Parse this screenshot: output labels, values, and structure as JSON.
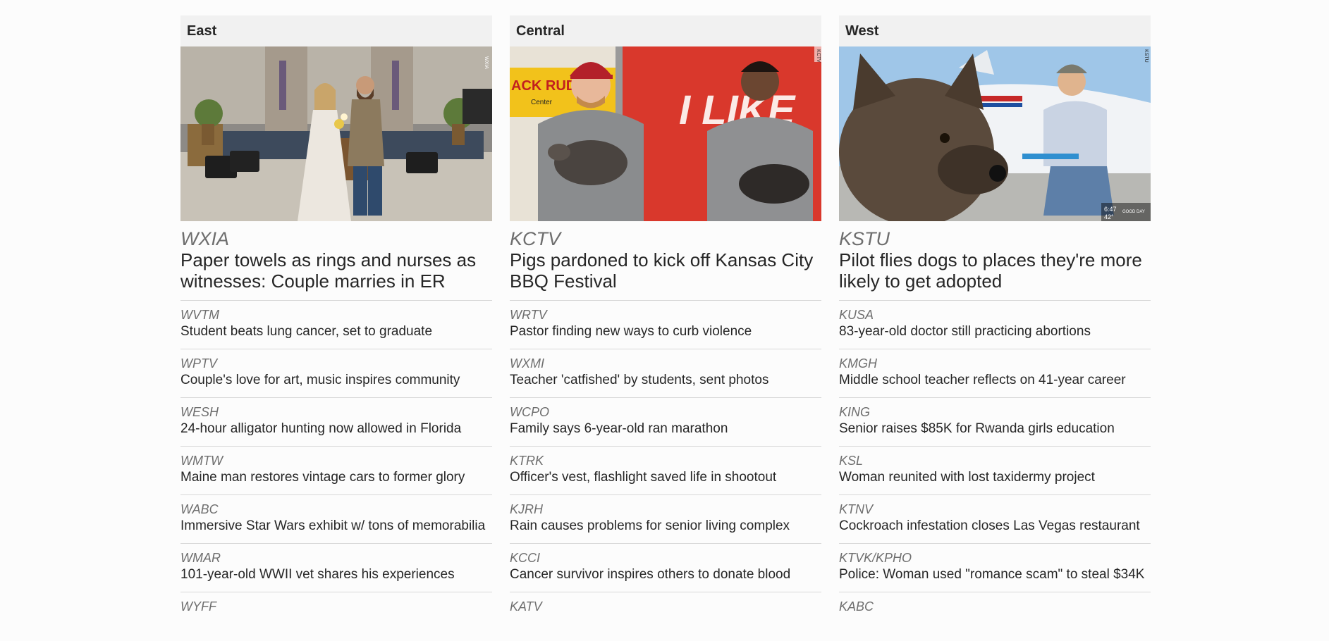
{
  "columns": [
    {
      "region": "East",
      "image_alt": "Bride and groom standing at front of a church stage",
      "lead": {
        "station": "WXIA",
        "headline": "Paper towels as rings and nurses as witnesses: Couple marries in ER"
      },
      "stories": [
        {
          "station": "WVTM",
          "headline": "Student beats lung cancer, set to graduate"
        },
        {
          "station": "WPTV",
          "headline": "Couple's love for art, music inspires community"
        },
        {
          "station": "WESH",
          "headline": "24-hour alligator hunting now allowed in Florida"
        },
        {
          "station": "WMTW",
          "headline": "Maine man restores vintage cars to former glory"
        },
        {
          "station": "WABC",
          "headline": "Immersive Star Wars exhibit w/ tons of memorabilia"
        },
        {
          "station": "WMAR",
          "headline": "101-year-old WWII vet shares his experiences"
        },
        {
          "station": "WYFF",
          "headline": ""
        }
      ]
    },
    {
      "region": "Central",
      "image_alt": "Two men holding small pigs in front of a red sign",
      "lead": {
        "station": "KCTV",
        "headline": "Pigs pardoned to kick off Kansas City BBQ Festival"
      },
      "stories": [
        {
          "station": "WRTV",
          "headline": "Pastor finding new ways to curb violence"
        },
        {
          "station": "WXMI",
          "headline": "Teacher 'catfished' by students, sent photos"
        },
        {
          "station": "WCPO",
          "headline": "Family says 6-year-old ran marathon"
        },
        {
          "station": "KTRK",
          "headline": "Officer's vest, flashlight saved life in shootout"
        },
        {
          "station": "KJRH",
          "headline": "Rain causes problems for senior living complex"
        },
        {
          "station": "KCCI",
          "headline": "Cancer survivor inspires others to donate blood"
        },
        {
          "station": "KATV",
          "headline": ""
        }
      ]
    },
    {
      "region": "West",
      "image_alt": "Dog close-up with pilot sitting by a small airplane",
      "lead": {
        "station": "KSTU",
        "headline": "Pilot flies dogs to places they're more likely to get adopted"
      },
      "stories": [
        {
          "station": "KUSA",
          "headline": "83-year-old doctor still practicing abortions"
        },
        {
          "station": "KMGH",
          "headline": "Middle school teacher reflects on 41-year career"
        },
        {
          "station": "KING",
          "headline": "Senior raises $85K for Rwanda girls education"
        },
        {
          "station": "KSL",
          "headline": "Woman reunited with lost taxidermy project"
        },
        {
          "station": "KTNV",
          "headline": "Cockroach infestation closes Las Vegas restaurant"
        },
        {
          "station": "KTVK/KPHO",
          "headline": "Police: Woman used \"romance scam\" to steal $34K"
        },
        {
          "station": "KABC",
          "headline": ""
        }
      ]
    }
  ],
  "image_overlays": {
    "east_bug": "WXIA",
    "central_bug": "KCTV",
    "central_sign": "I LIKE",
    "central_banner": "ACK RUDNAY",
    "central_banner_sub": "Center",
    "west_bug": "KSTU",
    "west_time": "6:47",
    "west_temp": "42°",
    "west_show": "GOOD DAY"
  }
}
